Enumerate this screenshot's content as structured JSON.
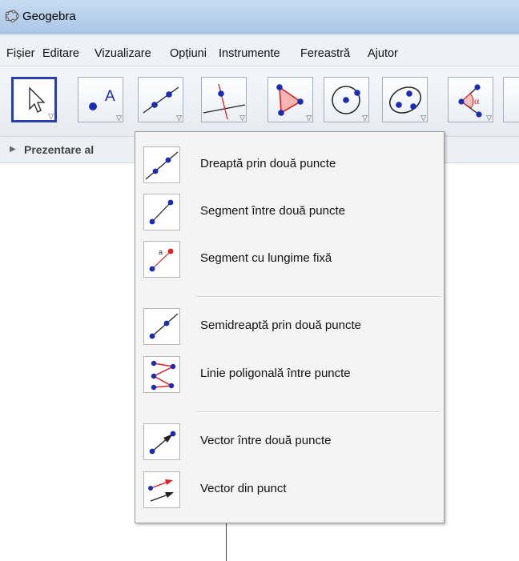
{
  "window": {
    "title": "Geogebra",
    "app_icon": "geogebra-ellipse-icon"
  },
  "menubar": {
    "items": [
      "Fișier",
      "Editare",
      "Vizualizare",
      "Opțiuni",
      "Instrumente",
      "Fereastră",
      "Ajutor"
    ]
  },
  "toolbar": {
    "tools": [
      {
        "name": "move-tool",
        "icon": "cursor-arrow-icon",
        "selected": true
      },
      {
        "name": "point-tool",
        "icon": "point-A-icon"
      },
      {
        "name": "line-tool",
        "icon": "line-two-points-icon"
      },
      {
        "name": "perpendicular-tool",
        "icon": "perpendicular-line-icon"
      },
      {
        "name": "polygon-tool",
        "icon": "polygon-triangle-icon"
      },
      {
        "name": "circle-tool",
        "icon": "circle-center-point-icon"
      },
      {
        "name": "conic-tool",
        "icon": "ellipse-points-icon"
      },
      {
        "name": "angle-tool",
        "icon": "angle-alpha-icon"
      }
    ],
    "angle_symbol": "α",
    "point_label": "A"
  },
  "panel": {
    "label": "Prezentare al"
  },
  "dropdown": {
    "items": [
      {
        "label": "Dreaptă prin două puncte",
        "icon": "line-through-two-points-icon"
      },
      {
        "label": "Segment între două puncte",
        "icon": "segment-two-points-icon"
      },
      {
        "label": "Segment cu lungime fixă",
        "icon": "segment-fixed-length-icon",
        "sublabel": "a"
      },
      {
        "label": "Semidreaptă prin două puncte",
        "icon": "ray-two-points-icon"
      },
      {
        "label": "Linie poligonală între puncte",
        "icon": "polyline-icon"
      },
      {
        "label": "Vector între două puncte",
        "icon": "vector-two-points-icon"
      },
      {
        "label": "Vector din punct",
        "icon": "vector-from-point-icon"
      }
    ]
  },
  "colors": {
    "accent": "#2b3fa8",
    "point": "#1a2bb8",
    "red": "#e02020"
  }
}
